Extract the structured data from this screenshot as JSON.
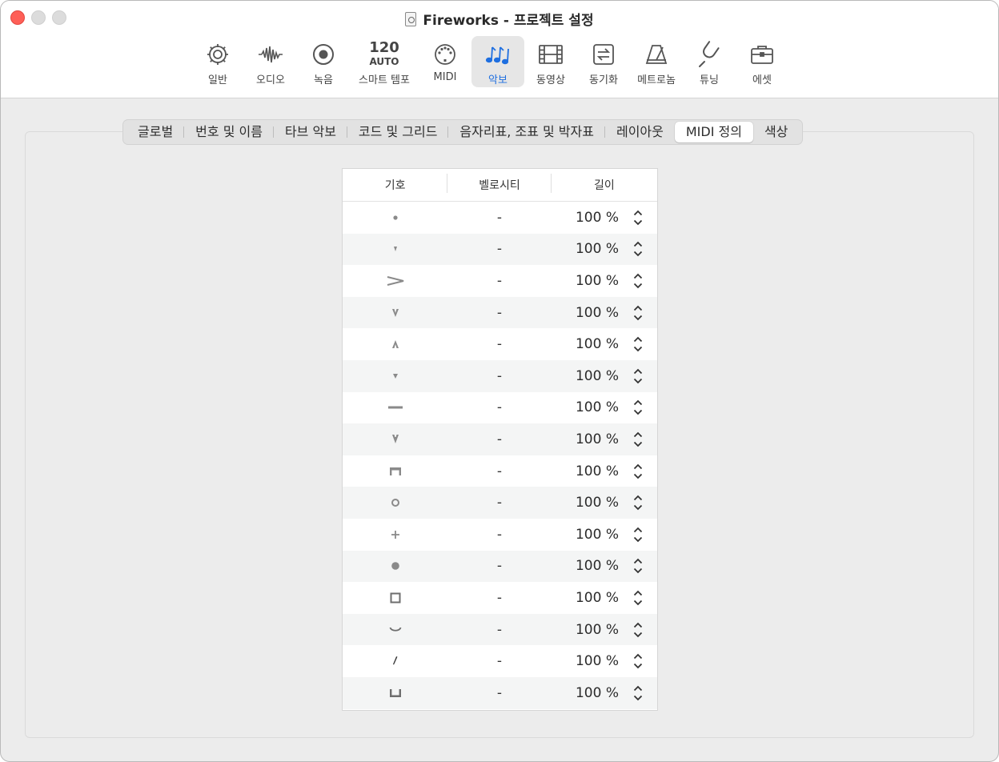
{
  "window": {
    "title": "Fireworks - 프로젝트 설정"
  },
  "toolbar": {
    "items": [
      {
        "id": "general",
        "label": "일반",
        "icon": "gear-icon"
      },
      {
        "id": "audio",
        "label": "오디오",
        "icon": "waveform-icon"
      },
      {
        "id": "record",
        "label": "녹음",
        "icon": "record-icon"
      },
      {
        "id": "smart-tempo",
        "label": "스마트 템포",
        "tempo_value": "120",
        "tempo_mode": "AUTO"
      },
      {
        "id": "midi",
        "label": "MIDI",
        "icon": "midi-port-icon"
      },
      {
        "id": "score",
        "label": "악보",
        "icon": "music-notes-icon",
        "active": true
      },
      {
        "id": "movie",
        "label": "동영상",
        "icon": "film-icon"
      },
      {
        "id": "sync",
        "label": "동기화",
        "icon": "sync-icon"
      },
      {
        "id": "metronome",
        "label": "메트로놈",
        "icon": "metronome-icon"
      },
      {
        "id": "tuning",
        "label": "튜닝",
        "icon": "tuning-fork-icon"
      },
      {
        "id": "assets",
        "label": "에셋",
        "icon": "briefcase-icon"
      }
    ],
    "accent_color": "#1f6fe0"
  },
  "tabs": [
    {
      "label": "글로벌"
    },
    {
      "label": "번호 및 이름"
    },
    {
      "label": "타브 악보"
    },
    {
      "label": "코드 및 그리드"
    },
    {
      "label": "음자리표, 조표 및 박자표"
    },
    {
      "label": "레이아웃"
    },
    {
      "label": "MIDI 정의",
      "active": true
    },
    {
      "label": "색상"
    }
  ],
  "table": {
    "headers": [
      "기호",
      "벨로시티",
      "길이"
    ],
    "rows": [
      {
        "symbol": "staccato-dot-icon",
        "velocity": "-",
        "length": "100 %"
      },
      {
        "symbol": "staccatissimo-icon",
        "velocity": "-",
        "length": "100 %"
      },
      {
        "symbol": "accent-icon",
        "velocity": "-",
        "length": "100 %"
      },
      {
        "symbol": "marcato-down-icon",
        "velocity": "-",
        "length": "100 %"
      },
      {
        "symbol": "marcato-up-icon",
        "velocity": "-",
        "length": "100 %"
      },
      {
        "symbol": "wedge-icon",
        "velocity": "-",
        "length": "100 %"
      },
      {
        "symbol": "tenuto-icon",
        "velocity": "-",
        "length": "100 %"
      },
      {
        "symbol": "marcato-staccato-icon",
        "velocity": "-",
        "length": "100 %"
      },
      {
        "symbol": "fermata-square-icon",
        "velocity": "-",
        "length": "100 %"
      },
      {
        "symbol": "harmonic-circle-icon",
        "velocity": "-",
        "length": "100 %"
      },
      {
        "symbol": "plus-icon",
        "velocity": "-",
        "length": "100 %"
      },
      {
        "symbol": "filled-dot-icon",
        "velocity": "-",
        "length": "100 %"
      },
      {
        "symbol": "square-icon",
        "velocity": "-",
        "length": "100 %"
      },
      {
        "symbol": "arc-icon",
        "velocity": "-",
        "length": "100 %"
      },
      {
        "symbol": "slash-icon",
        "velocity": "-",
        "length": "100 %"
      },
      {
        "symbol": "bracket-icon",
        "velocity": "-",
        "length": "100 %"
      }
    ]
  }
}
